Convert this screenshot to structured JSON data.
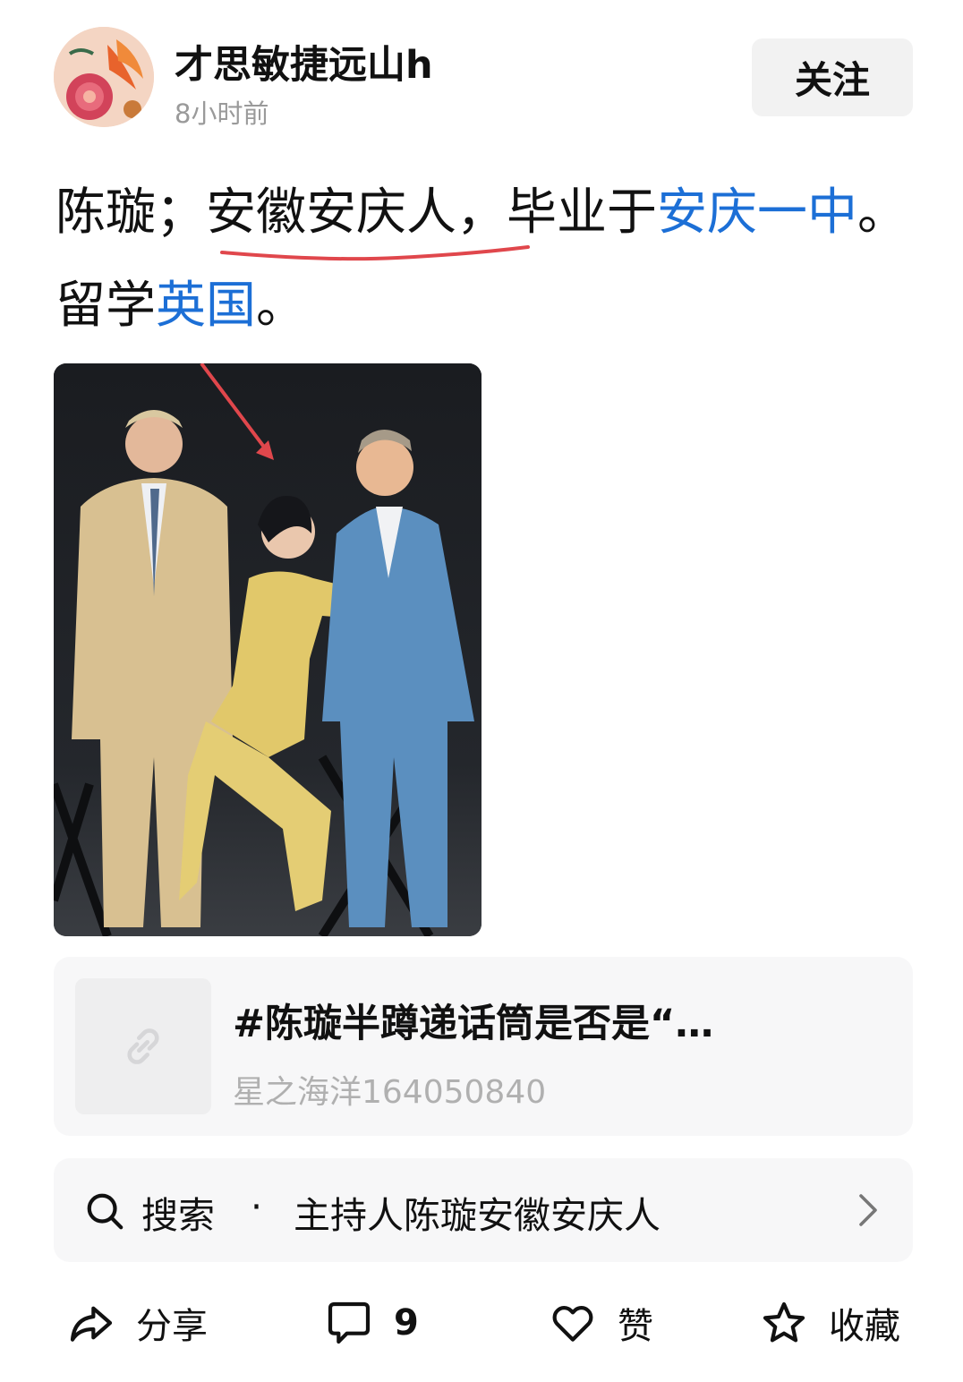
{
  "header": {
    "username": "才思敏捷远山h",
    "timestamp": "8小时前",
    "follow_label": "关注"
  },
  "post": {
    "text_segments": {
      "s1": "陈璇；",
      "s2": "安徽安庆人，",
      "s3": "毕业于",
      "s4": "安庆一中",
      "s5": "。留学",
      "s6": "英国",
      "s7": "。"
    },
    "link_color": "#1c6fd6",
    "annotation_color": "#e0474c"
  },
  "link_card": {
    "title": "#陈璇半蹲递话筒是否是“…",
    "author": "星之海洋164050840",
    "icon": "link-icon"
  },
  "search": {
    "label": "搜索",
    "separator": "·",
    "query": "主持人陈璇安徽安庆人",
    "icon": "search-icon"
  },
  "actions": {
    "share_label": "分享",
    "comment_count": "9",
    "like_label": "赞",
    "favorite_label": "收藏"
  }
}
